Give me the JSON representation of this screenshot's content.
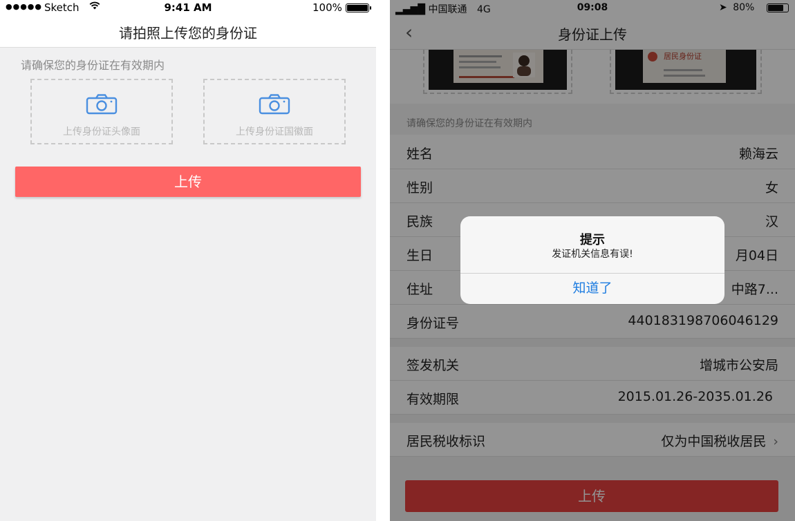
{
  "left": {
    "status": {
      "signal": "●●●●●",
      "carrier": "Sketch",
      "time": "9:41 AM",
      "battery": "100%",
      "battery_level": 1.0
    },
    "title": "请拍照上传您的身份证",
    "hint": "请确保您的身份证在有效期内",
    "upload_front_label": "上传身份证头像面",
    "upload_back_label": "上传身份证国徽面",
    "upload_button": "上传",
    "accent_color": "#ff6666",
    "icon_color": "#4a8fe0"
  },
  "right": {
    "status": {
      "carrier": "中国联通",
      "network": "4G",
      "time": "09:08",
      "battery": "80%",
      "battery_level": 0.8
    },
    "title": "身份证上传",
    "back": "‹",
    "hint": "请确保您的身份证在有效期内",
    "fields": [
      {
        "label": "姓名",
        "value": "赖海云"
      },
      {
        "label": "性别",
        "value": "女"
      },
      {
        "label": "民族",
        "value": "汉"
      },
      {
        "label": "生日",
        "value": "月04日"
      },
      {
        "label": "住址",
        "value": "中路7..."
      },
      {
        "label": "身份证号",
        "value": "440183198706046129"
      }
    ],
    "fields2": [
      {
        "label": "签发机关",
        "value": "增城市公安局"
      },
      {
        "label": "有效期限",
        "value": "2015.01.26-2035.01.26"
      }
    ],
    "tax": {
      "label": "居民税收标识",
      "value": "仅为中国税收居民"
    },
    "upload_button": "上传",
    "card_back_text": "居民身份证",
    "dialog": {
      "title": "提示",
      "message": "发证机关信息有误!",
      "button": "知道了"
    },
    "accent_color": "#e6413f"
  }
}
